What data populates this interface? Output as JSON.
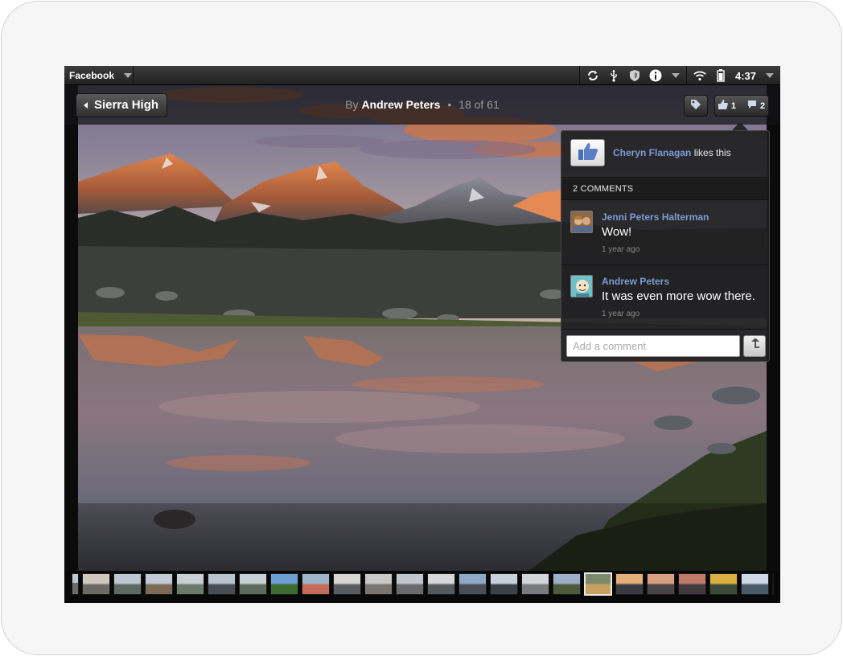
{
  "statusbar": {
    "app_name": "Facebook",
    "clock": "4:37",
    "icons": [
      "sync-icon",
      "usb-icon",
      "shield-icon",
      "info-icon",
      "wifi-icon",
      "battery-icon"
    ]
  },
  "header": {
    "back_label": "Sierra High",
    "by_prefix": "By",
    "author": "Andrew Peters",
    "separator": "•",
    "position": "18 of 61",
    "likes_count": "1",
    "comments_count": "2"
  },
  "popup": {
    "liker": "Cheryn Flanagan",
    "likes_suffix": "likes this",
    "comments_header": "2 COMMENTS",
    "comments": [
      {
        "author": "Jenni Peters Halterman",
        "text": "Wow!",
        "time": "1 year ago"
      },
      {
        "author": "Andrew Peters",
        "text": "It was even more wow there.",
        "time": "1 year ago"
      }
    ],
    "input_placeholder": "Add a comment"
  },
  "filmstrip": {
    "count": 23,
    "selected_index": 16
  },
  "colors": {
    "link": "#7d9bd6",
    "background": "#0b0b0b",
    "popup": "#202022"
  }
}
